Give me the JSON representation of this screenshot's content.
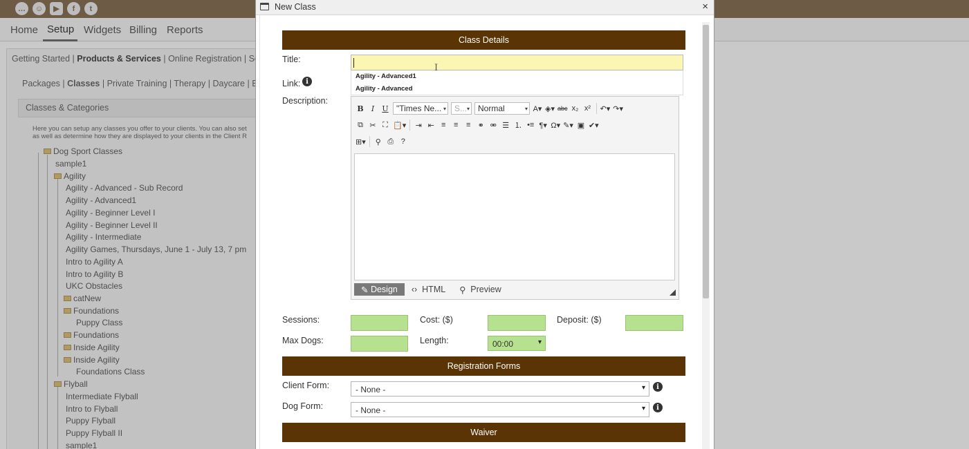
{
  "social_icons": [
    "chat-icon",
    "support-icon",
    "youtube-icon",
    "facebook-icon",
    "twitter-icon"
  ],
  "nav": {
    "items": [
      "Home",
      "Setup",
      "Widgets",
      "Billing",
      "Reports"
    ],
    "active": "Setup"
  },
  "subnav": {
    "items": [
      "Getting Started",
      "Products & Services",
      "Online Registration",
      "Setti"
    ],
    "active": "Products & Services"
  },
  "subnav2": {
    "items": [
      "Packages",
      "Classes",
      "Private Training",
      "Therapy",
      "Daycare",
      "Boa"
    ],
    "active": "Classes"
  },
  "categories": {
    "title": "Classes & Categories",
    "intro_line1": "Here you can setup any classes you offer to your clients. You can also set",
    "intro_line2": "as well as determine how they are displayed to your clients in the Client R",
    "tree": [
      "Dog Sport Classes",
      "sample1",
      "Agility",
      "Agility - Advanced - Sub Record",
      "Agility - Advanced1",
      "Agility - Beginner Level I",
      "Agility - Beginner Level II",
      "Agility - Intermediate",
      "Agility Games, Thursdays, June 1 - July 13, 7 pm",
      "Intro to Agility A",
      "Intro to Agility B",
      "UKC Obstacles",
      "catNew",
      "Foundations",
      "Puppy Class",
      "Foundations",
      "Inside Agility",
      "Inside Agility",
      "Foundations Class",
      "Flyball",
      "Intermediate Flyball",
      "Intro to Flyball",
      "Puppy Flyball",
      "Puppy Flyball II",
      "sample1"
    ]
  },
  "dialog": {
    "title": "New Class",
    "close": "×",
    "class_details": {
      "header": "Class Details",
      "title_label": "Title:",
      "title_value": "",
      "link_label": "Link:",
      "description_label": "Description:",
      "autocomplete": [
        "Agility - Advanced1",
        "Agility - Advanced"
      ]
    },
    "editor": {
      "font_name": "\"Times Ne...",
      "font_size": "S...",
      "format": "Normal",
      "modes": [
        "Design",
        "HTML",
        "Preview"
      ],
      "active_mode": "Design"
    },
    "fields": {
      "sessions_label": "Sessions:",
      "cost_label": "Cost: ($)",
      "deposit_label": "Deposit: ($)",
      "max_dogs_label": "Max Dogs:",
      "length_label": "Length:",
      "length_value": "00:00"
    },
    "registration": {
      "header": "Registration Forms",
      "client_form_label": "Client Form:",
      "client_form_value": "- None -",
      "dog_form_label": "Dog Form:",
      "dog_form_value": "- None -"
    },
    "waiver": {
      "header": "Waiver"
    }
  }
}
